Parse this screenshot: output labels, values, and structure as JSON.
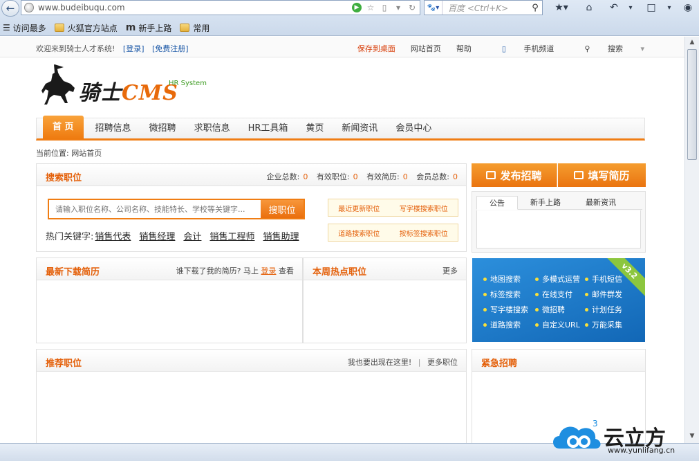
{
  "browser": {
    "url": "www.budeibuqu.com",
    "search_placeholder": "百度 <Ctrl+K>",
    "bookmarks": [
      "访问最多",
      "火狐官方站点",
      "新手上路",
      "常用"
    ]
  },
  "topbar": {
    "welcome": "欢迎来到骑士人才系统!",
    "login": "[登录]",
    "register": "[免费注册]",
    "links": [
      "保存到桌面",
      "网站首页",
      "帮助",
      "手机频道",
      "搜索"
    ]
  },
  "logo": {
    "title": "骑士",
    "cms": "CMS",
    "subtitle": "HR System"
  },
  "nav": [
    "首 页",
    "招聘信息",
    "微招聘",
    "求职信息",
    "HR工具箱",
    "黄页",
    "新闻资讯",
    "会员中心"
  ],
  "breadcrumb": "当前位置:  网站首页",
  "search_panel": {
    "title": "搜索职位",
    "stats": [
      {
        "label": "企业总数:",
        "value": "0"
      },
      {
        "label": "有效职位:",
        "value": "0"
      },
      {
        "label": "有效简历:",
        "value": "0"
      },
      {
        "label": "会员总数:",
        "value": "0"
      }
    ],
    "placeholder": "请输入职位名称、公司名称、技能特长、学校等关键字...",
    "button": "搜职位",
    "hot_label": "热门关键字:",
    "hot_keywords": [
      "销售代表",
      "销售经理",
      "会计",
      "销售工程师",
      "销售助理"
    ],
    "quick1": [
      "最近更新职位",
      "写字楼搜索职位"
    ],
    "quick2": [
      "道路搜索职位",
      "按标签搜索职位"
    ]
  },
  "actions": {
    "publish": "发布招聘",
    "resume": "填写简历"
  },
  "notice_tabs": [
    "公告",
    "新手上路",
    "最新资讯"
  ],
  "promo": {
    "version": "v3.2",
    "items": [
      "地图搜索",
      "多模式运营",
      "手机短信",
      "标签搜索",
      "在线支付",
      "邮件群发",
      "写字楼搜索",
      "微招聘",
      "计划任务",
      "道路搜索",
      "自定义URL",
      "万能采集"
    ]
  },
  "resume_panel": {
    "title": "最新下载简历",
    "right_text": "谁下载了我的简历? 马上",
    "right_link": "登录",
    "right_after": "查看"
  },
  "hot_jobs_panel": {
    "title": "本周热点职位",
    "more": "更多"
  },
  "recommend_panel": {
    "title": "推荐职位",
    "right_text": "我也要出现在这里!",
    "sep": "|",
    "more": "更多职位"
  },
  "urgent_panel": {
    "title": "紧急招聘"
  },
  "watermark": {
    "text": "云立方",
    "url": "www.yunlifang.cn"
  }
}
